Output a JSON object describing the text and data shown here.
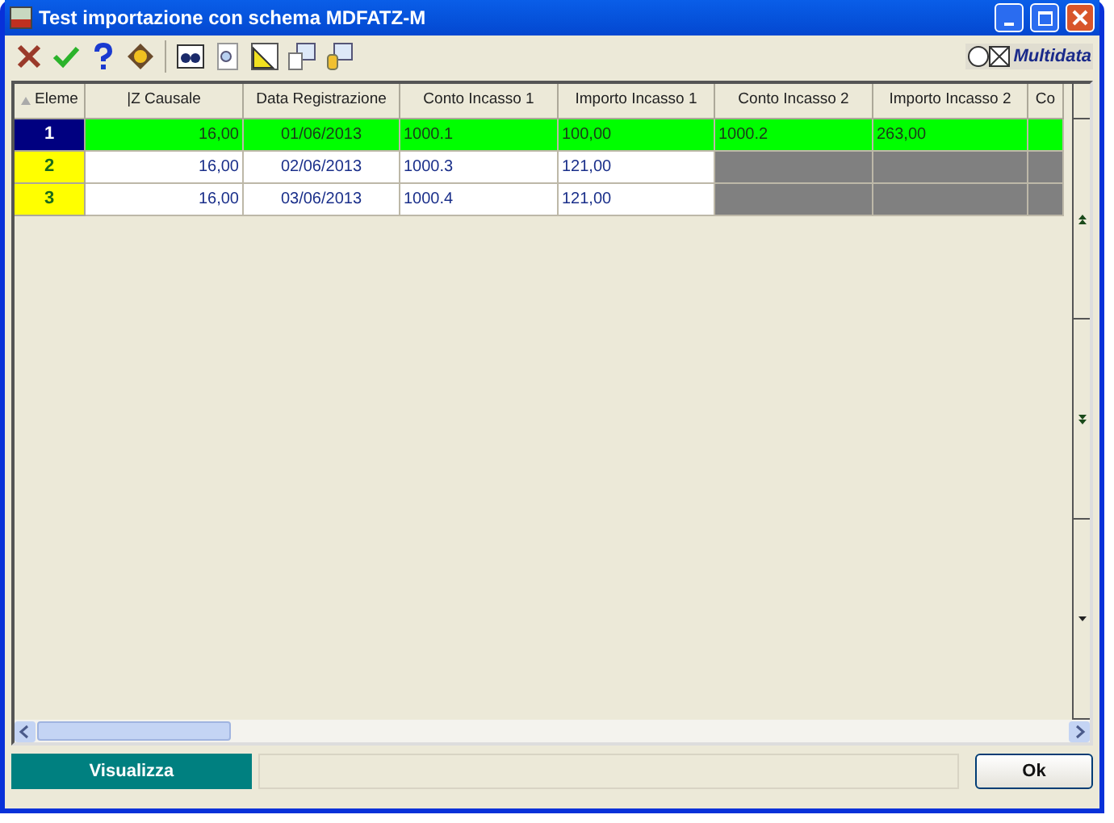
{
  "window": {
    "title": "Test importazione con schema MDFATZ-M"
  },
  "toolbar": {
    "brand": "Multidata"
  },
  "table": {
    "columns": [
      {
        "label": "Eleme",
        "kind": "index"
      },
      {
        "label": "|Z Causale",
        "kind": "number"
      },
      {
        "label": "Data Registrazione",
        "kind": "date"
      },
      {
        "label": "Conto Incasso 1",
        "kind": "text"
      },
      {
        "label": "Importo Incasso 1",
        "kind": "text"
      },
      {
        "label": "Conto Incasso 2",
        "kind": "text"
      },
      {
        "label": "Importo Incasso 2",
        "kind": "text"
      },
      {
        "label": "Co",
        "kind": "text"
      }
    ],
    "rows": [
      {
        "selected": true,
        "cells": [
          {
            "kind": "index",
            "text": "1"
          },
          {
            "kind": "value",
            "text": "16,00"
          },
          {
            "kind": "value",
            "text": "01/06/2013"
          },
          {
            "kind": "value",
            "text": "1000.1"
          },
          {
            "kind": "value",
            "text": "100,00"
          },
          {
            "kind": "value",
            "text": "1000.2"
          },
          {
            "kind": "value",
            "text": "263,00"
          },
          {
            "kind": "blank"
          }
        ]
      },
      {
        "selected": false,
        "cells": [
          {
            "kind": "index",
            "text": "2"
          },
          {
            "kind": "value",
            "text": "16,00"
          },
          {
            "kind": "value",
            "text": "02/06/2013"
          },
          {
            "kind": "value",
            "text": "1000.3"
          },
          {
            "kind": "value",
            "text": "121,00"
          },
          {
            "kind": "missing"
          },
          {
            "kind": "missing"
          },
          {
            "kind": "missing"
          }
        ]
      },
      {
        "selected": false,
        "cells": [
          {
            "kind": "index",
            "text": "3"
          },
          {
            "kind": "value",
            "text": "16,00"
          },
          {
            "kind": "value",
            "text": "03/06/2013"
          },
          {
            "kind": "value",
            "text": "1000.4"
          },
          {
            "kind": "value",
            "text": "121,00"
          },
          {
            "kind": "missing"
          },
          {
            "kind": "missing"
          },
          {
            "kind": "missing"
          }
        ]
      }
    ]
  },
  "footer": {
    "primary_button": "Visualizza",
    "ok_button": "Ok"
  }
}
